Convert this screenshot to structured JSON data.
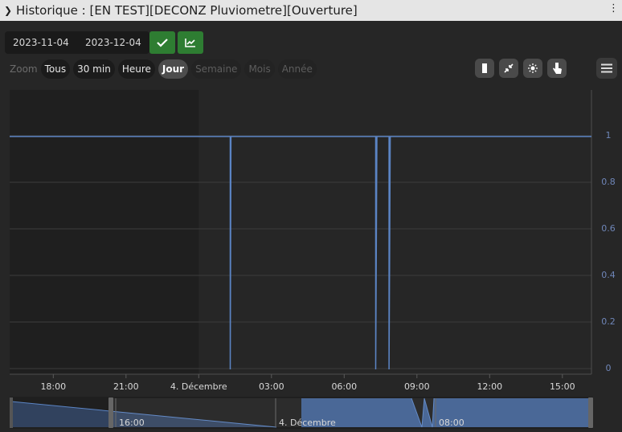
{
  "title": "Historique : [EN TEST][DECONZ Pluviometre][Ouverture]",
  "dates": {
    "start": "2023-11-04",
    "end": "2023-12-04"
  },
  "zoom": {
    "label": "Zoom",
    "buttons": [
      "Tous",
      "30 min",
      "Heure",
      "Jour",
      "Semaine",
      "Mois",
      "Année"
    ],
    "active": "Jour",
    "disabled": [
      "Semaine",
      "Mois",
      "Année"
    ]
  },
  "tools": [
    "column-icon",
    "compress-icon",
    "light-icon",
    "pointer-icon"
  ],
  "colors": {
    "series": "#5b84c4",
    "navigator_fill": "#3f5f91",
    "accent_green": "#2e7d32"
  },
  "chart_data": {
    "type": "line",
    "step": true,
    "x_ticks": [
      "18:00",
      "21:00",
      "4. Décembre",
      "03:00",
      "06:00",
      "09:00",
      "12:00",
      "15:00"
    ],
    "y_ticks": [
      "1",
      "0.8",
      "0.6",
      "0.4",
      "0.2",
      "0"
    ],
    "ylim": [
      0,
      1
    ],
    "xlim_hours": [
      -7.8,
      16.2
    ],
    "series": [
      {
        "values_desc": "state vs time (hours from 4 Dec 00:00)",
        "points": [
          [
            -7.8,
            1
          ],
          [
            1.3,
            1
          ],
          [
            1.3,
            0
          ],
          [
            1.33,
            1
          ],
          [
            7.3,
            1
          ],
          [
            7.3,
            0
          ],
          [
            7.35,
            1
          ],
          [
            7.85,
            1
          ],
          [
            7.85,
            0
          ],
          [
            7.9,
            1
          ],
          [
            16.2,
            1
          ]
        ]
      }
    ],
    "navigator": {
      "x_ticks": [
        "16:00",
        "4. Décembre",
        "08:00"
      ]
    }
  }
}
